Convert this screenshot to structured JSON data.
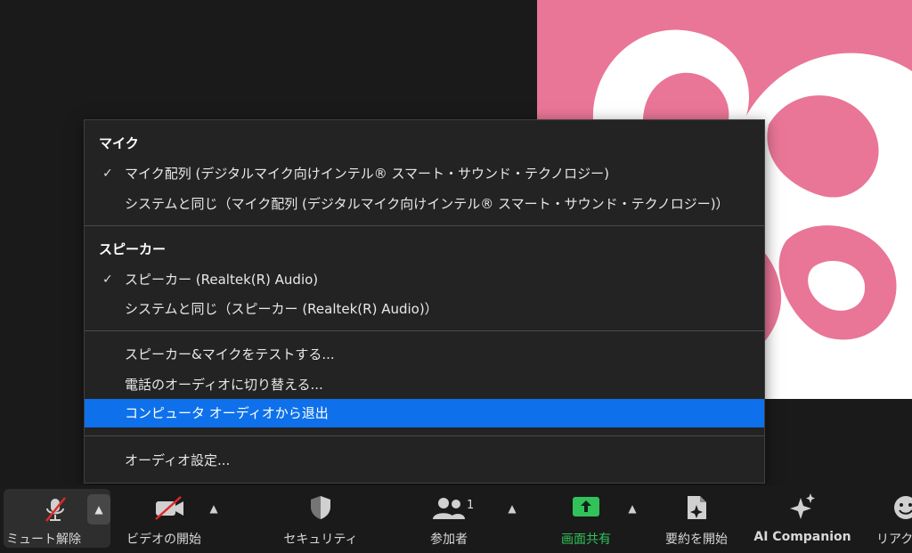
{
  "menu": {
    "sections": [
      {
        "header": "マイク",
        "items": [
          {
            "label": "マイク配列 (デジタルマイク向けインテル® スマート・サウンド・テクノロジー)",
            "checked": true
          },
          {
            "label": "システムと同じ（マイク配列 (デジタルマイク向けインテル® スマート・サウンド・テクノロジー)）",
            "checked": false
          }
        ]
      },
      {
        "header": "スピーカー",
        "items": [
          {
            "label": "スピーカー (Realtek(R) Audio)",
            "checked": true
          },
          {
            "label": "システムと同じ（スピーカー (Realtek(R) Audio)）",
            "checked": false
          }
        ]
      }
    ],
    "actions": [
      "スピーカー&マイクをテストする...",
      "電話のオーディオに切り替える...",
      "コンピュータ オーディオから退出"
    ],
    "settings": "オーディオ設定...",
    "selected_action": "コンピュータ オーディオから退出",
    "check_glyph": "✓"
  },
  "toolbar": {
    "unmute": "ミュート解除",
    "start_video": "ビデオの開始",
    "security": "セキュリティ",
    "participants": "参加者",
    "participants_count": "1",
    "share_screen": "画面共有",
    "start_summary": "要約を開始",
    "ai_companion": "AI Companion",
    "reactions": "リアクシ"
  },
  "colors": {
    "highlight": "#0e71eb",
    "share_green": "#31c25a",
    "video_bg": "#e97597",
    "mute_red": "#e02828"
  }
}
